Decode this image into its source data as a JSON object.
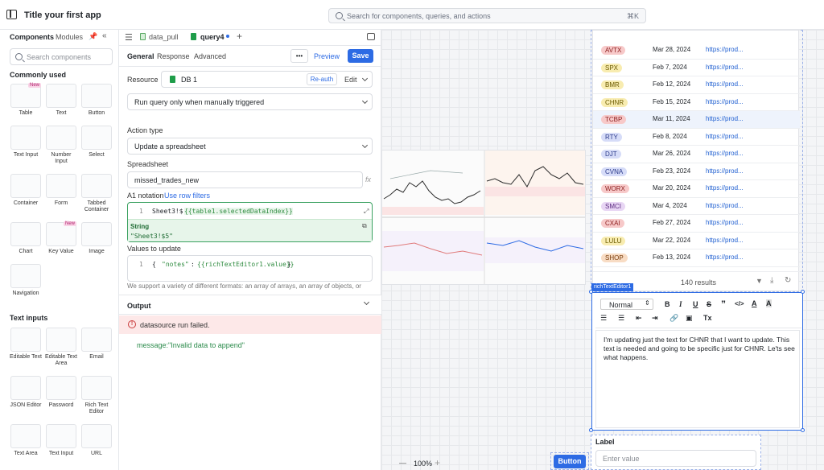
{
  "app": {
    "title": "Title your first app",
    "search_placeholder": "Search for components, queries, and actions",
    "search_shortcut": "⌘K"
  },
  "left": {
    "tabs": [
      "Components",
      "Modules"
    ],
    "search_placeholder": "Search components",
    "commonly_used": "Commonly used",
    "text_inputs": "Text inputs",
    "new_badge": "New",
    "tiles_common": [
      "Table",
      "Text",
      "Button",
      "Text Input",
      "Number Input",
      "Select",
      "Container",
      "Form",
      "Tabbed Container",
      "Chart",
      "Key Value",
      "Image",
      "Navigation"
    ],
    "tiles_text": [
      "Editable Text",
      "Editable Text Area",
      "Email",
      "JSON Editor",
      "Password",
      "Rich Text Editor",
      "Text Area",
      "Text Input",
      "URL"
    ]
  },
  "editor": {
    "tabs": [
      "data_pull",
      "query4"
    ],
    "subtabs": [
      "General",
      "Response",
      "Advanced"
    ],
    "more": "•••",
    "preview": "Preview",
    "save": "Save",
    "resource_label": "Resource",
    "resource_value": "DB 1",
    "reauth": "Re-auth",
    "edit": "Edit",
    "trigger": "Run query only when manually triggered",
    "action_type_label": "Action type",
    "action_type": "Update a spreadsheet",
    "spreadsheet_label": "Spreadsheet",
    "spreadsheet": "missed_trades_new",
    "fx": "fx",
    "a1_label": "A1 notation",
    "use_row_filters": "Use row filters",
    "line_no": "1",
    "a1_prefix": "Sheet3!$",
    "a1_code": "{{table1.selectedDataIndex}}",
    "hint_type": "String",
    "hint_value": "\"Sheet3!$5\"",
    "values_label": "Values to update",
    "values_open": "{",
    "values_key": "\"notes\"",
    "values_colon": ":",
    "values_code": "{{richTextEditor1.value}}",
    "values_close": "}",
    "support_text": "We support a variety of different formats: an array of arrays, an array of objects, or",
    "output_label": "Output",
    "error": "datasource run failed.",
    "message_key": "message:",
    "message_val": "\"Invalid data to append\""
  },
  "table": {
    "rows": [
      {
        "sym": "AVTX",
        "date": "Mar 28, 2024",
        "link": "https://prod...",
        "color": "#f7c9c9",
        "tc": "#8a1c1c"
      },
      {
        "sym": "SPX",
        "date": "Feb 7, 2024",
        "link": "https://prod...",
        "color": "#f8ecb0",
        "tc": "#6b5a00"
      },
      {
        "sym": "BMR",
        "date": "Feb 12, 2024",
        "link": "https://prod...",
        "color": "#f8ecb0",
        "tc": "#6b5a00"
      },
      {
        "sym": "CHNR",
        "date": "Feb 15, 2024",
        "link": "https://prod...",
        "color": "#f8ecb0",
        "tc": "#6b5a00"
      },
      {
        "sym": "TCBP",
        "date": "Mar 11, 2024",
        "link": "https://prod...",
        "color": "#f7c9c9",
        "tc": "#8a1c1c"
      },
      {
        "sym": "RTY",
        "date": "Feb 8, 2024",
        "link": "https://prod...",
        "color": "#d6dcf8",
        "tc": "#2b3a8a"
      },
      {
        "sym": "DJT",
        "date": "Mar 26, 2024",
        "link": "https://prod...",
        "color": "#d6dcf8",
        "tc": "#2b3a8a"
      },
      {
        "sym": "CVNA",
        "date": "Feb 23, 2024",
        "link": "https://prod...",
        "color": "#d6dcf8",
        "tc": "#2b3a8a"
      },
      {
        "sym": "WORX",
        "date": "Mar 20, 2024",
        "link": "https://prod...",
        "color": "#f7c9c9",
        "tc": "#8a1c1c"
      },
      {
        "sym": "SMCI",
        "date": "Mar 4, 2024",
        "link": "https://prod...",
        "color": "#e8d6f4",
        "tc": "#5b2a80"
      },
      {
        "sym": "CXAI",
        "date": "Feb 27, 2024",
        "link": "https://prod...",
        "color": "#f7c9c9",
        "tc": "#8a1c1c"
      },
      {
        "sym": "LULU",
        "date": "Mar 22, 2024",
        "link": "https://prod...",
        "color": "#f8ecb0",
        "tc": "#6b5a00"
      },
      {
        "sym": "SHOP",
        "date": "Feb 13, 2024",
        "link": "https://prod...",
        "color": "#f8dcc4",
        "tc": "#7a3d0c"
      }
    ],
    "results": "140 results"
  },
  "rte": {
    "tag": "richTextEditor1",
    "style": "Normal",
    "text": "I'm updating just the text for CHNR that I want to update. This text is needed and going to be specific just for CHNR. Le'ts see what happens."
  },
  "bottom": {
    "zoom": "100%",
    "minus": "—",
    "plus": "+",
    "button": "Button",
    "label": "Label",
    "input_placeholder": "Enter value"
  }
}
